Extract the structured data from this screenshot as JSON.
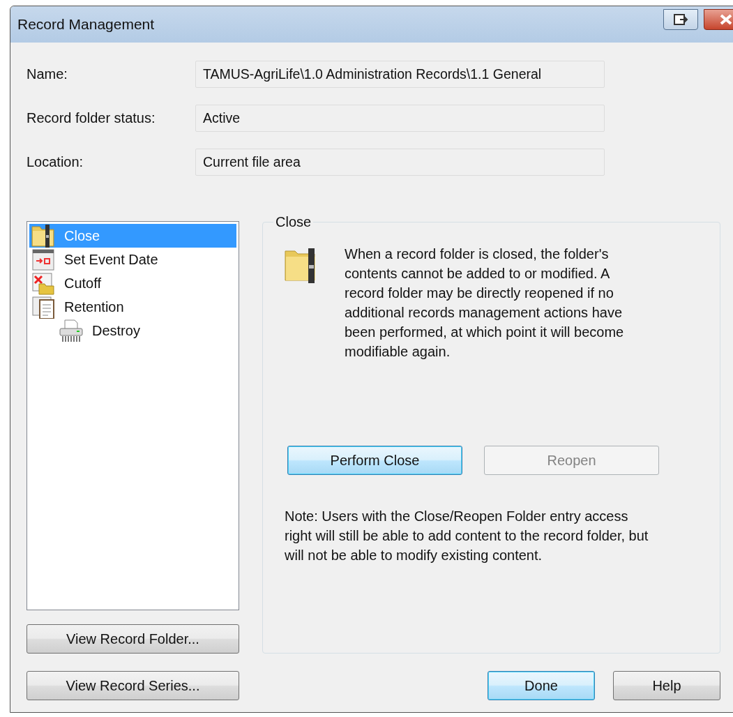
{
  "window": {
    "title": "Record Management"
  },
  "fields": [
    {
      "label": "Name:",
      "value": "TAMUS-AgriLife\\1.0 Administration Records\\1.1 General"
    },
    {
      "label": "Record folder status:",
      "value": "Active"
    },
    {
      "label": "Location:",
      "value": "Current file area"
    }
  ],
  "actions": [
    {
      "label": "Close",
      "kind": "close",
      "selected": true
    },
    {
      "label": "Set Event Date",
      "kind": "event",
      "selected": false
    },
    {
      "label": "Cutoff",
      "kind": "cutoff",
      "selected": false
    },
    {
      "label": "Retention",
      "kind": "retention",
      "selected": false,
      "children": [
        {
          "label": "Destroy",
          "kind": "destroy",
          "selected": false
        }
      ]
    }
  ],
  "left_buttons": [
    {
      "label": "View Record Folder...",
      "default": false,
      "disabled": false
    },
    {
      "label": "View Record Series...",
      "default": false,
      "disabled": false
    }
  ],
  "detail": {
    "title": "Close",
    "description": "When a record folder is closed, the folder's contents cannot be added to or modified. A record folder may be directly reopened if no additional records management actions have been performed, at which point it will become modifiable again.",
    "buttons": [
      {
        "label": "Perform Close",
        "default": true,
        "disabled": false
      },
      {
        "label": "Reopen",
        "default": false,
        "disabled": true
      }
    ],
    "note": "Note: Users with the Close/Reopen Folder entry access right will still be able to add content to the record folder, but will not be able to modify existing content."
  },
  "dialog_buttons": [
    {
      "label": "Done",
      "default": true,
      "disabled": false
    },
    {
      "label": "Help",
      "default": false,
      "disabled": false
    }
  ]
}
